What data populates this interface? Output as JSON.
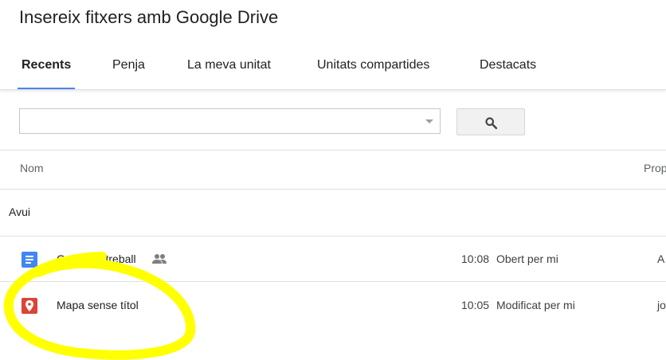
{
  "dialog": {
    "title": "Insereix fitxers amb Google Drive"
  },
  "tabs": [
    {
      "label": "Recents",
      "active": true
    },
    {
      "label": "Penja",
      "active": false
    },
    {
      "label": "La meva unitat",
      "active": false
    },
    {
      "label": "Unitats compartides",
      "active": false
    },
    {
      "label": "Destacats",
      "active": false
    }
  ],
  "search": {
    "value": "",
    "placeholder": "",
    "button_icon": "search-icon"
  },
  "columns": {
    "name": "Nom",
    "owner": "Prop"
  },
  "group": {
    "label": "Avui"
  },
  "files": [
    {
      "name": "Grups de treball",
      "type_icon": "google-docs-icon",
      "shared": true,
      "time": "10:08",
      "reason": "Obert per mi",
      "owner": "A"
    },
    {
      "name": "Mapa sense títol",
      "type_icon": "google-my-maps-icon",
      "shared": false,
      "time": "10:05",
      "reason": "Modificat per mi",
      "owner": "jo"
    }
  ],
  "colors": {
    "accent": "#4a86e8",
    "docs": "#4285f4",
    "maps": "#db4437",
    "highlight": "#ffff00"
  }
}
